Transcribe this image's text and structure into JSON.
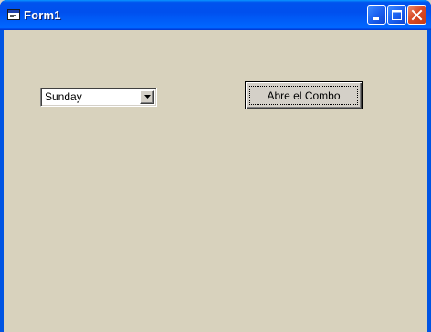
{
  "window": {
    "title": "Form1",
    "controls": {
      "minimize_icon": "minimize-icon",
      "maximize_icon": "maximize-icon",
      "close_icon": "close-icon"
    }
  },
  "form": {
    "combo": {
      "selected": "Sunday",
      "dropdown_icon": "chevron-down-icon"
    },
    "button": {
      "label": "Abre el Combo"
    }
  },
  "colors": {
    "titlebar": "#0054e3",
    "client_background": "#d8d2bd",
    "close_button": "#d94a26"
  }
}
